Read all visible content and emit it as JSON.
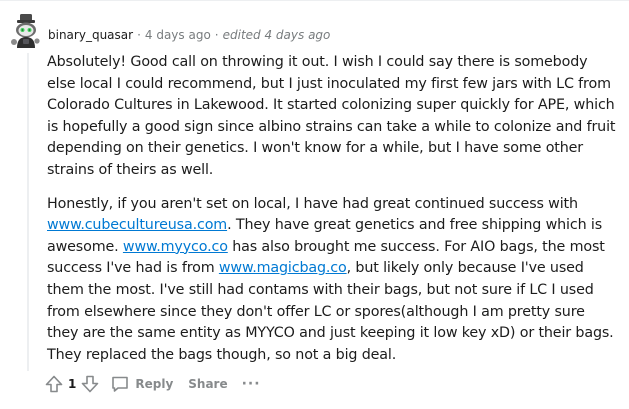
{
  "comment": {
    "username": "binary_quasar",
    "time_ago": "4 days ago",
    "edited": "edited 4 days ago",
    "separator": "·",
    "paragraphs": [
      {
        "segments": [
          {
            "text": "Absolutely! Good call on throwing it out. I wish I could say there is somebody else local I could recommend, but I just inoculated my first few jars with LC from Colorado Cultures in Lakewood. It started colonizing super quickly for APE, which is hopefully a good sign since albino strains can take a while to colonize and fruit depending on their genetics. I won't know for a while, but I have some other strains of theirs as well."
          }
        ]
      },
      {
        "segments": [
          {
            "text": "Honestly, if you aren't set on local, I have had great continued success with "
          },
          {
            "link": "www.cubecultureusa.com"
          },
          {
            "text": ". They have great genetics and free shipping which is awesome. "
          },
          {
            "link": "www.myyco.co"
          },
          {
            "text": " has also brought me success. For AIO bags, the most success I've had is from "
          },
          {
            "link": "www.magicbag.co"
          },
          {
            "text": ", but likely only because I've used them the most. I've still had contams with their bags, but not sure if LC I used from elsewhere since they don't offer LC or spores(although I am pretty sure they are the same entity as MYYCO and just keeping it low key xD) or their bags. They replaced the bags though, so not a big deal."
          }
        ]
      }
    ],
    "votes": "1",
    "reply_label": "Reply",
    "share_label": "Share",
    "more_label": "···"
  },
  "icons": {
    "upvote": "upvote-arrow-icon",
    "downvote": "downvote-arrow-icon",
    "reply": "comment-bubble-icon",
    "avatar": "snoo-avatar-icon"
  },
  "colors": {
    "link": "#0079d3",
    "text": "#1c1c1c",
    "meta": "#787c7e",
    "action": "#878a8c",
    "thread_line": "#edeff1"
  }
}
